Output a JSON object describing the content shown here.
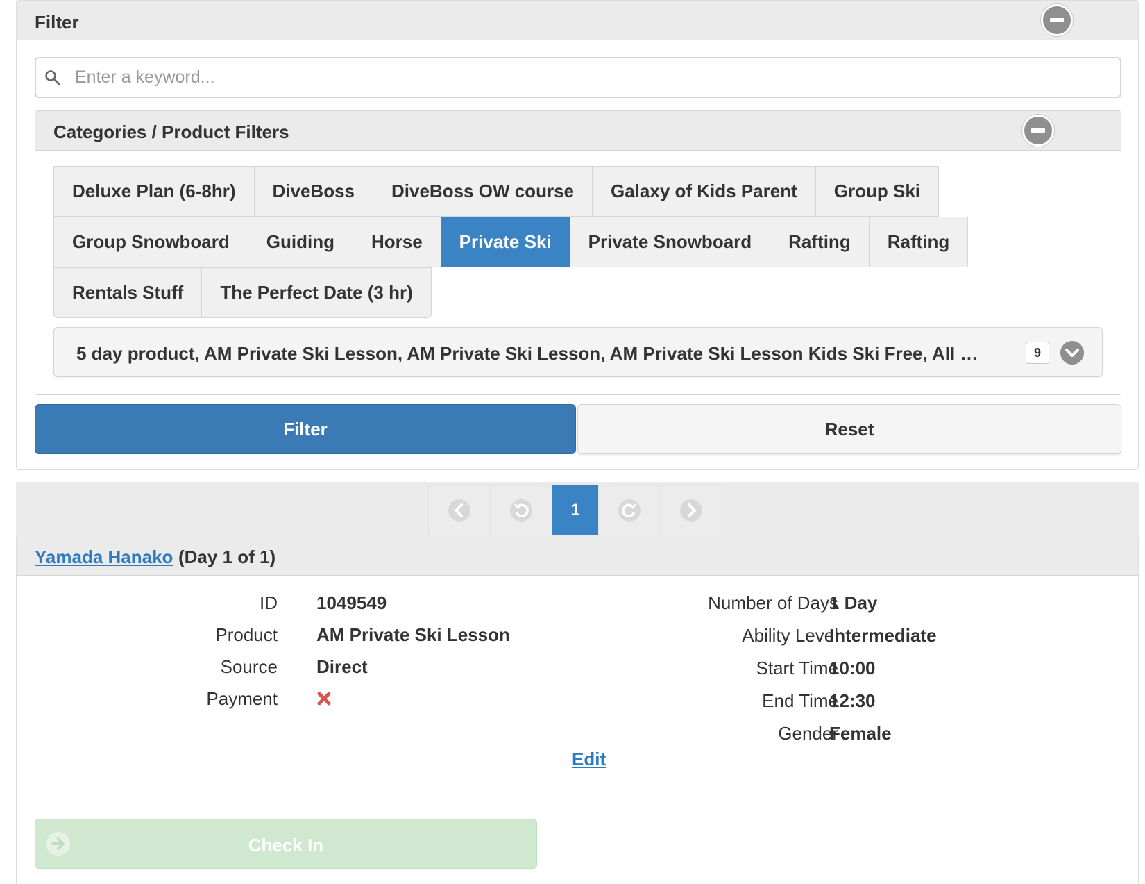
{
  "filter_panel": {
    "title": "Filter",
    "search": {
      "placeholder": "Enter a keyword...",
      "value": ""
    },
    "categories": {
      "title": "Categories / Product Filters",
      "rows": [
        [
          "Deluxe Plan (6-8hr)",
          "DiveBoss",
          "DiveBoss OW course",
          "Galaxy of Kids Parent",
          "Group Ski"
        ],
        [
          "Group Snowboard",
          "Guiding",
          "Horse",
          "Private Ski",
          "Private Snowboard",
          "Rafting",
          "Rafting"
        ],
        [
          "Rentals Stuff",
          "The Perfect Date (3 hr)"
        ]
      ],
      "active": "Private Ski"
    },
    "product_select": {
      "text": "5 day product, AM Private Ski Lesson, AM Private Ski Lesson, AM Private Ski Lesson Kids Ski Free, All Da...",
      "count": "9"
    },
    "filter_button": "Filter",
    "reset_button": "Reset"
  },
  "pagination": {
    "current": "1"
  },
  "record": {
    "name": "Yamada Hanako",
    "day": "(Day 1 of 1)",
    "left_fields": [
      {
        "label": "ID",
        "value": "1049549"
      },
      {
        "label": "Product",
        "value": "AM Private Ski Lesson"
      },
      {
        "label": "Source",
        "value": "Direct"
      },
      {
        "label": "Payment",
        "value": ""
      }
    ],
    "right_fields": [
      {
        "label": "Number of Days",
        "value": "1 Day"
      },
      {
        "label": "Ability Level",
        "value": "Intermediate"
      },
      {
        "label": "Start Time",
        "value": "10:00"
      },
      {
        "label": "End Time",
        "value": "12:30"
      },
      {
        "label": "Gender",
        "value": "Female"
      }
    ],
    "payment_status_icon": "x-mark-icon",
    "edit_link": "Edit",
    "checkin_button": "Check In"
  },
  "colors": {
    "primary": "#3a7bb6",
    "active_tab": "#3a83c4",
    "link": "#2f7bbf",
    "error": "#d9534f",
    "checkin_disabled": "#cfe8cf"
  }
}
